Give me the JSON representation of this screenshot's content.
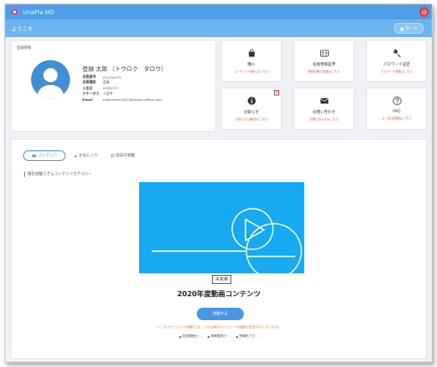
{
  "header": {
    "app_title": "UnaPla MD",
    "welcome": "ようこそ",
    "home_button": "ホーム"
  },
  "member": {
    "card_header": "会員情報",
    "name": "登録 太郎 （トウロク　タロウ）",
    "rows": [
      {
        "label": "会員番号",
        "value": "J01234073"
      },
      {
        "label": "会員種別",
        "value": "会員"
      },
      {
        "label": "入会日",
        "value": "2020/7/7"
      },
      {
        "label": "ステータス",
        "value": "入会中"
      },
      {
        "label": "Email",
        "value": "toushiman1001@saison-office.com"
      }
    ]
  },
  "tiles": [
    {
      "title": "購入",
      "desc": "コンテンツの購入はこちら",
      "icon": "shopping-bag-icon"
    },
    {
      "title": "会員情報変更",
      "desc": "登録情報の変更はこちら",
      "icon": "id-card-icon"
    },
    {
      "title": "パスワード設定",
      "desc": "パスワード変更はこちら",
      "icon": "key-icon"
    },
    {
      "title": "お知らせ",
      "desc": "お知らせの確認はこちら",
      "icon": "info-icon",
      "badge": "✕"
    },
    {
      "title": "お問い合わせ",
      "desc": "お問い合わせはこちら",
      "icon": "envelope-icon"
    },
    {
      "title": "FAQ",
      "desc": "よくある質問はこちら",
      "icon": "question-icon"
    }
  ],
  "tabs": [
    {
      "label": "コンテンツ",
      "active": true
    },
    {
      "label": "お気に入り",
      "active": false
    },
    {
      "label": "過去の視聴",
      "active": false
    }
  ],
  "category_label": "現在視聴できるコンテンツカテゴリー",
  "content": {
    "status": "未受講",
    "title": "2020年度動画コンテンツ",
    "watch_button": "視聴する",
    "notice": "このカテゴリーの視聴では、これ以降のカテゴリーの視聴の意思がなくなります。",
    "meta": [
      {
        "icon": "tag-icon",
        "label": "初回視聴日：-"
      },
      {
        "icon": "tag-icon",
        "label": "視聴期限日：-"
      },
      {
        "icon": "tag-icon",
        "label": "受講終了日：-"
      }
    ]
  },
  "colors": {
    "topbar": "#4f9ee8",
    "subbar": "#6db3f0",
    "accent_orange": "#e85b3b",
    "thumbnail": "#17aaf3",
    "logout": "#e0403a"
  }
}
